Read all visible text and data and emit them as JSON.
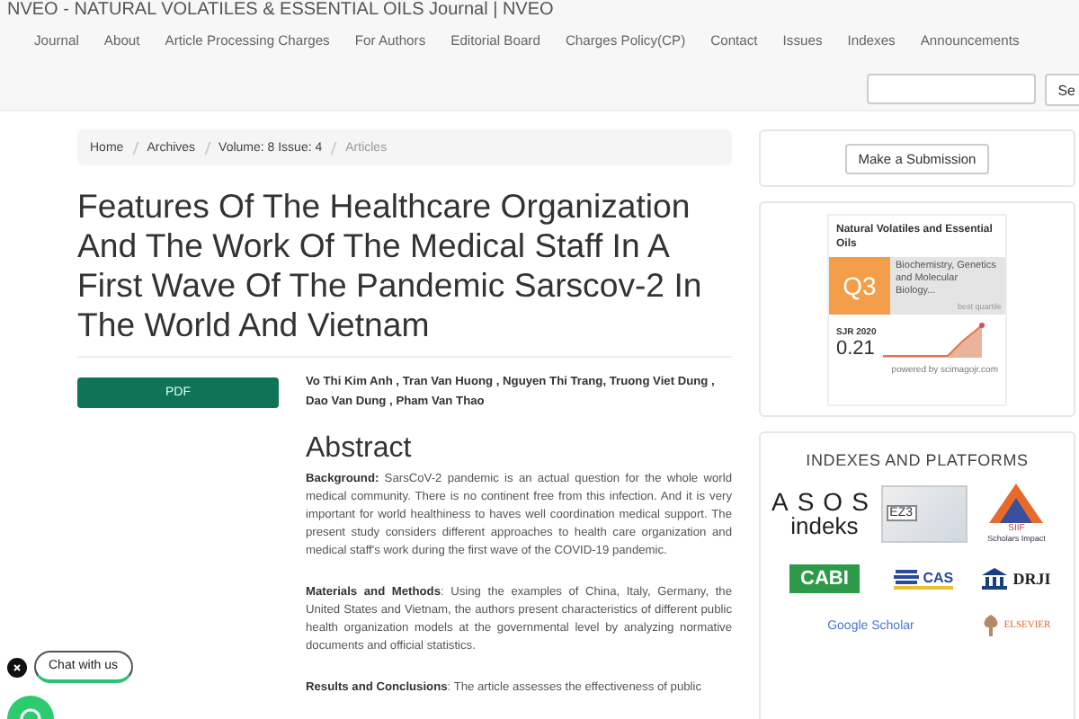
{
  "site_title": "NVEO - NATURAL VOLATILES & ESSENTIAL OILS Journal | NVEO",
  "nav": [
    "Journal",
    "About",
    "Article Processing Charges",
    "For Authors",
    "Editorial Board",
    "Charges Policy(CP)",
    "Contact",
    "Issues",
    "Indexes",
    "Announcements"
  ],
  "search": {
    "button": "Se"
  },
  "breadcrumb": [
    {
      "label": "Home",
      "current": false
    },
    {
      "label": "Archives",
      "current": false
    },
    {
      "label": "Volume: 8 Issue: 4",
      "current": false
    },
    {
      "label": "Articles",
      "current": true
    }
  ],
  "article": {
    "title": "Features Of The Healthcare Organization And The Work Of The Medical Staff In A First Wave Of The Pandemic Sarscov-2 In The World And Vietnam",
    "pdf_button": "PDF",
    "authors": "Vo Thi Kim Anh , Tran Van Huong , Nguyen Thi Trang, Truong Viet Dung , Dao Van Dung , Pham Van Thao",
    "abstract_heading": "Abstract",
    "abstract": [
      "**Background:** SarsCoV-2 pandemic is an actual question for the whole world medical community. There is no continent free from this infection. And it is very important for world healthiness to haves well coordination medical support. The present study considers different approaches to health care organization and medical staff's work during the first wave of the COVID-19 pandemic.",
      "**Materials and Methods**: Using the examples of China, Italy, Germany, the United States and Vietnam, the authors present characteristics of different public health organization models at the governmental level by analyzing normative documents and official statistics.",
      "**Results and Conclusions**: The article assesses the effectiveness of public"
    ]
  },
  "sidebar": {
    "submission_button": "Make a Submission",
    "sjr": {
      "journal": "Natural Volatiles and Essential Oils",
      "quartile": "Q3",
      "category": "Biochemistry, Genetics and Molecular Biology...",
      "quartile_note": "best quartile",
      "year": "SJR 2020",
      "value": "0.21",
      "powered": "powered by scimagojr.com"
    },
    "indexes_heading": "INDEXES AND PLATFORMS",
    "logos": [
      {
        "kind": "asos",
        "texts": [
          "ASOS",
          "indeks"
        ]
      },
      {
        "kind": "ez3",
        "texts": [
          "EZ3"
        ]
      },
      {
        "kind": "sif",
        "texts": [
          "SIIF",
          "Scholars Impact"
        ]
      },
      {
        "kind": "cabi",
        "texts": [
          "CABI"
        ]
      },
      {
        "kind": "cas",
        "texts": [
          "CAS"
        ]
      },
      {
        "kind": "drji",
        "texts": [
          "DRJI"
        ]
      },
      {
        "kind": "google",
        "texts": [
          "Google Scholar"
        ]
      },
      {
        "kind": "elsevier",
        "texts": [
          "ELSEVIER"
        ]
      }
    ]
  },
  "chat": {
    "label": "Chat with us"
  }
}
